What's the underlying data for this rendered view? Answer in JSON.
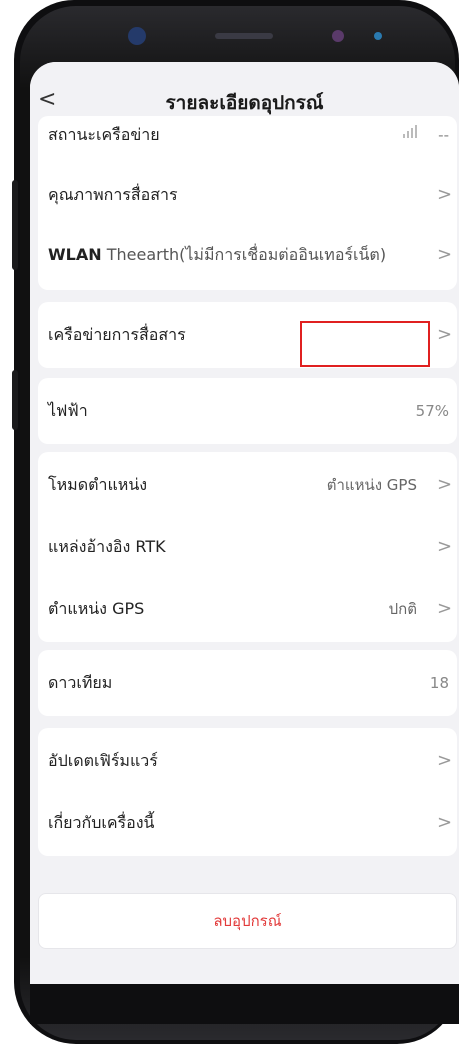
{
  "nav": {
    "back_icon": "chevron-left-icon",
    "back_glyph": "<",
    "title": "รายละเอียดอุปกรณ์"
  },
  "groups": {
    "network": {
      "status": {
        "label": "สถานะเครือข่าย",
        "value": "--",
        "icon": "signal-icon"
      },
      "quality": {
        "label": "คุณภาพการสื่อสาร"
      },
      "wlan": {
        "label_bold": "WLAN",
        "label_rest": "Theearth(ไม่มีการเชื่อมต่ออินเทอร์เน็ต)"
      }
    },
    "comm": {
      "network": {
        "label": "เครือข่ายการสื่อสาร"
      }
    },
    "power": {
      "battery": {
        "label": "ไฟฟ้า",
        "value": "57%"
      }
    },
    "position": {
      "mode": {
        "label": "โหมดตำแหน่ง",
        "value": "ตำแหน่ง GPS"
      },
      "rtk": {
        "label": "แหล่งอ้างอิง RTK"
      },
      "gps": {
        "label": "ตำแหน่ง GPS",
        "value": "ปกติ"
      }
    },
    "satellite": {
      "count": {
        "label": "ดาวเทียม",
        "value": "18"
      }
    },
    "about": {
      "firmware": {
        "label": "อัปเดตเฟิร์มแวร์"
      },
      "device": {
        "label": "เกี่ยวกับเครื่องนี้"
      }
    }
  },
  "delete_button": "ลบอุปกรณ์",
  "chevron_glyph": ">",
  "colors": {
    "delete": "#e23a3a",
    "highlight": "#e02020",
    "background": "#f2f2f5"
  }
}
